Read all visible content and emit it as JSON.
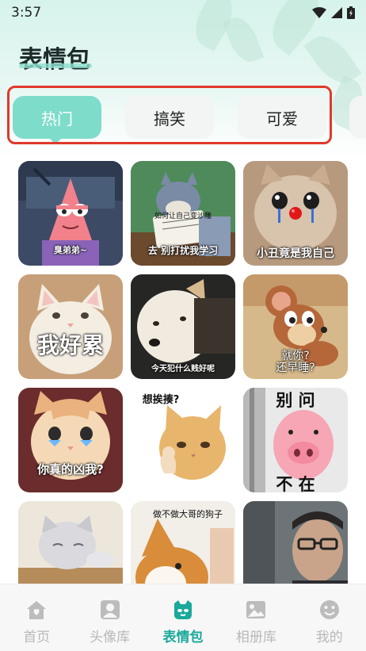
{
  "status_bar": {
    "time": "3:57"
  },
  "header": {
    "title": "表情包"
  },
  "tabs": [
    {
      "label": "热门",
      "active": true
    },
    {
      "label": "搞笑",
      "active": false
    },
    {
      "label": "可爱",
      "active": false
    }
  ],
  "grid": [
    {
      "icon": "patrick-star-meme",
      "caption": "臭弟弟~"
    },
    {
      "icon": "tom-cat-reading-meme",
      "caption": "去 别打扰我学习",
      "sub_caption": "如何让自己变沙雕"
    },
    {
      "icon": "crying-cat-meme",
      "caption": "小丑竟是我自己"
    },
    {
      "icon": "white-kitten-meme",
      "caption": "我好累"
    },
    {
      "icon": "white-dog-meme",
      "caption": "今天犯什么贱好呢"
    },
    {
      "icon": "jerry-mouse-meme",
      "caption": "就你?\n还早睡?"
    },
    {
      "icon": "teary-cat-meme",
      "caption": "你真的凶我?"
    },
    {
      "icon": "cat-flexing-meme",
      "caption": "想挨揍?"
    },
    {
      "icon": "pig-toy-meme",
      "caption": "别 问",
      "caption_bottom": "不 在"
    },
    {
      "icon": "sleepy-cat-meme",
      "caption": ""
    },
    {
      "icon": "corgi-meme",
      "caption": "做不做大哥的狗子"
    },
    {
      "icon": "man-glasses-meme",
      "caption": ""
    }
  ],
  "bottom_nav": [
    {
      "label": "首页",
      "icon": "home-icon",
      "active": false
    },
    {
      "label": "头像库",
      "icon": "avatar-icon",
      "active": false
    },
    {
      "label": "表情包",
      "icon": "emoji-pack-icon",
      "active": true
    },
    {
      "label": "相册库",
      "icon": "album-icon",
      "active": false
    },
    {
      "label": "我的",
      "icon": "smiley-icon",
      "active": false
    }
  ],
  "colors": {
    "accent": "#7edcca",
    "nav_active": "#1aa99a",
    "highlight_border": "#e0392b"
  }
}
